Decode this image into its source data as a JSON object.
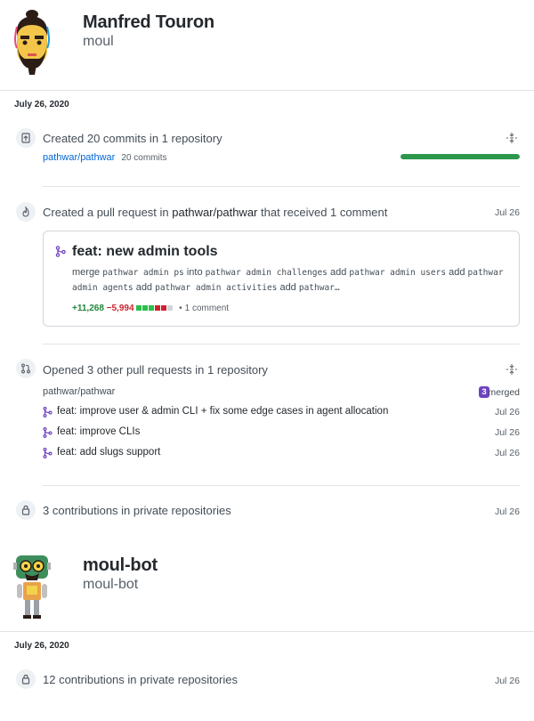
{
  "profiles": [
    {
      "name": "Manfred Touron",
      "login": "moul",
      "date": "July 26, 2020",
      "activities": [
        {
          "title": "Created 20 commits in 1 repository",
          "repo": "pathwar/pathwar",
          "commits": "20 commits",
          "progress": 1.0
        },
        {
          "title_prefix": "Created a pull request in ",
          "title_repo": "pathwar/pathwar",
          "title_suffix": " that received 1 comment",
          "date": "Jul 26",
          "card": {
            "title": "feat: new admin tools",
            "body": [
              {
                "t": "text",
                "v": "merge "
              },
              {
                "t": "code",
                "v": "pathwar admin ps"
              },
              {
                "t": "text",
                "v": " into "
              },
              {
                "t": "code",
                "v": "pathwar admin challenges"
              },
              {
                "t": "text",
                "v": " add "
              },
              {
                "t": "code",
                "v": "pathwar admin users"
              },
              {
                "t": "text",
                "v": " add "
              },
              {
                "t": "code",
                "v": "pathwar admin agents"
              },
              {
                "t": "text",
                "v": " add "
              },
              {
                "t": "code",
                "v": "pathwar admin activities"
              },
              {
                "t": "text",
                "v": " add "
              },
              {
                "t": "code",
                "v": "pathwar…"
              }
            ],
            "additions": "+11,268",
            "deletions": "−5,994",
            "diffstat": [
              "add",
              "add",
              "add",
              "del",
              "del",
              "neutral"
            ],
            "comments": "1 comment",
            "separator": "•"
          }
        },
        {
          "title": "Opened 3 other pull requests in 1 repository",
          "repo": "pathwar/pathwar",
          "merged_count": "3",
          "merged_label": "merged",
          "items": [
            {
              "title": "feat: improve user & admin CLI + fix some edge cases in agent allocation",
              "date": "Jul 26"
            },
            {
              "title": "feat: improve CLIs",
              "date": "Jul 26"
            },
            {
              "title": "feat: add slugs support",
              "date": "Jul 26"
            }
          ]
        },
        {
          "title": "3 contributions in private repositories",
          "date": "Jul 26"
        }
      ]
    },
    {
      "name": "moul-bot",
      "login": "moul-bot",
      "date": "July 26, 2020",
      "activities": [
        {
          "title": "12 contributions in private repositories",
          "date": "Jul 26"
        }
      ]
    }
  ],
  "colors": {
    "link": "#0366d6",
    "progress": "#2c974b",
    "additions": "#22863a",
    "deletions": "#cb2431",
    "merged_badge": "#6f42c1"
  },
  "icons": {
    "commit": "repo-push-icon",
    "pull_request": "git-pull-request-icon",
    "created_pr": "flame-icon",
    "private": "lock-icon",
    "collapse": "fold-icon",
    "merged": "git-merge-icon"
  }
}
